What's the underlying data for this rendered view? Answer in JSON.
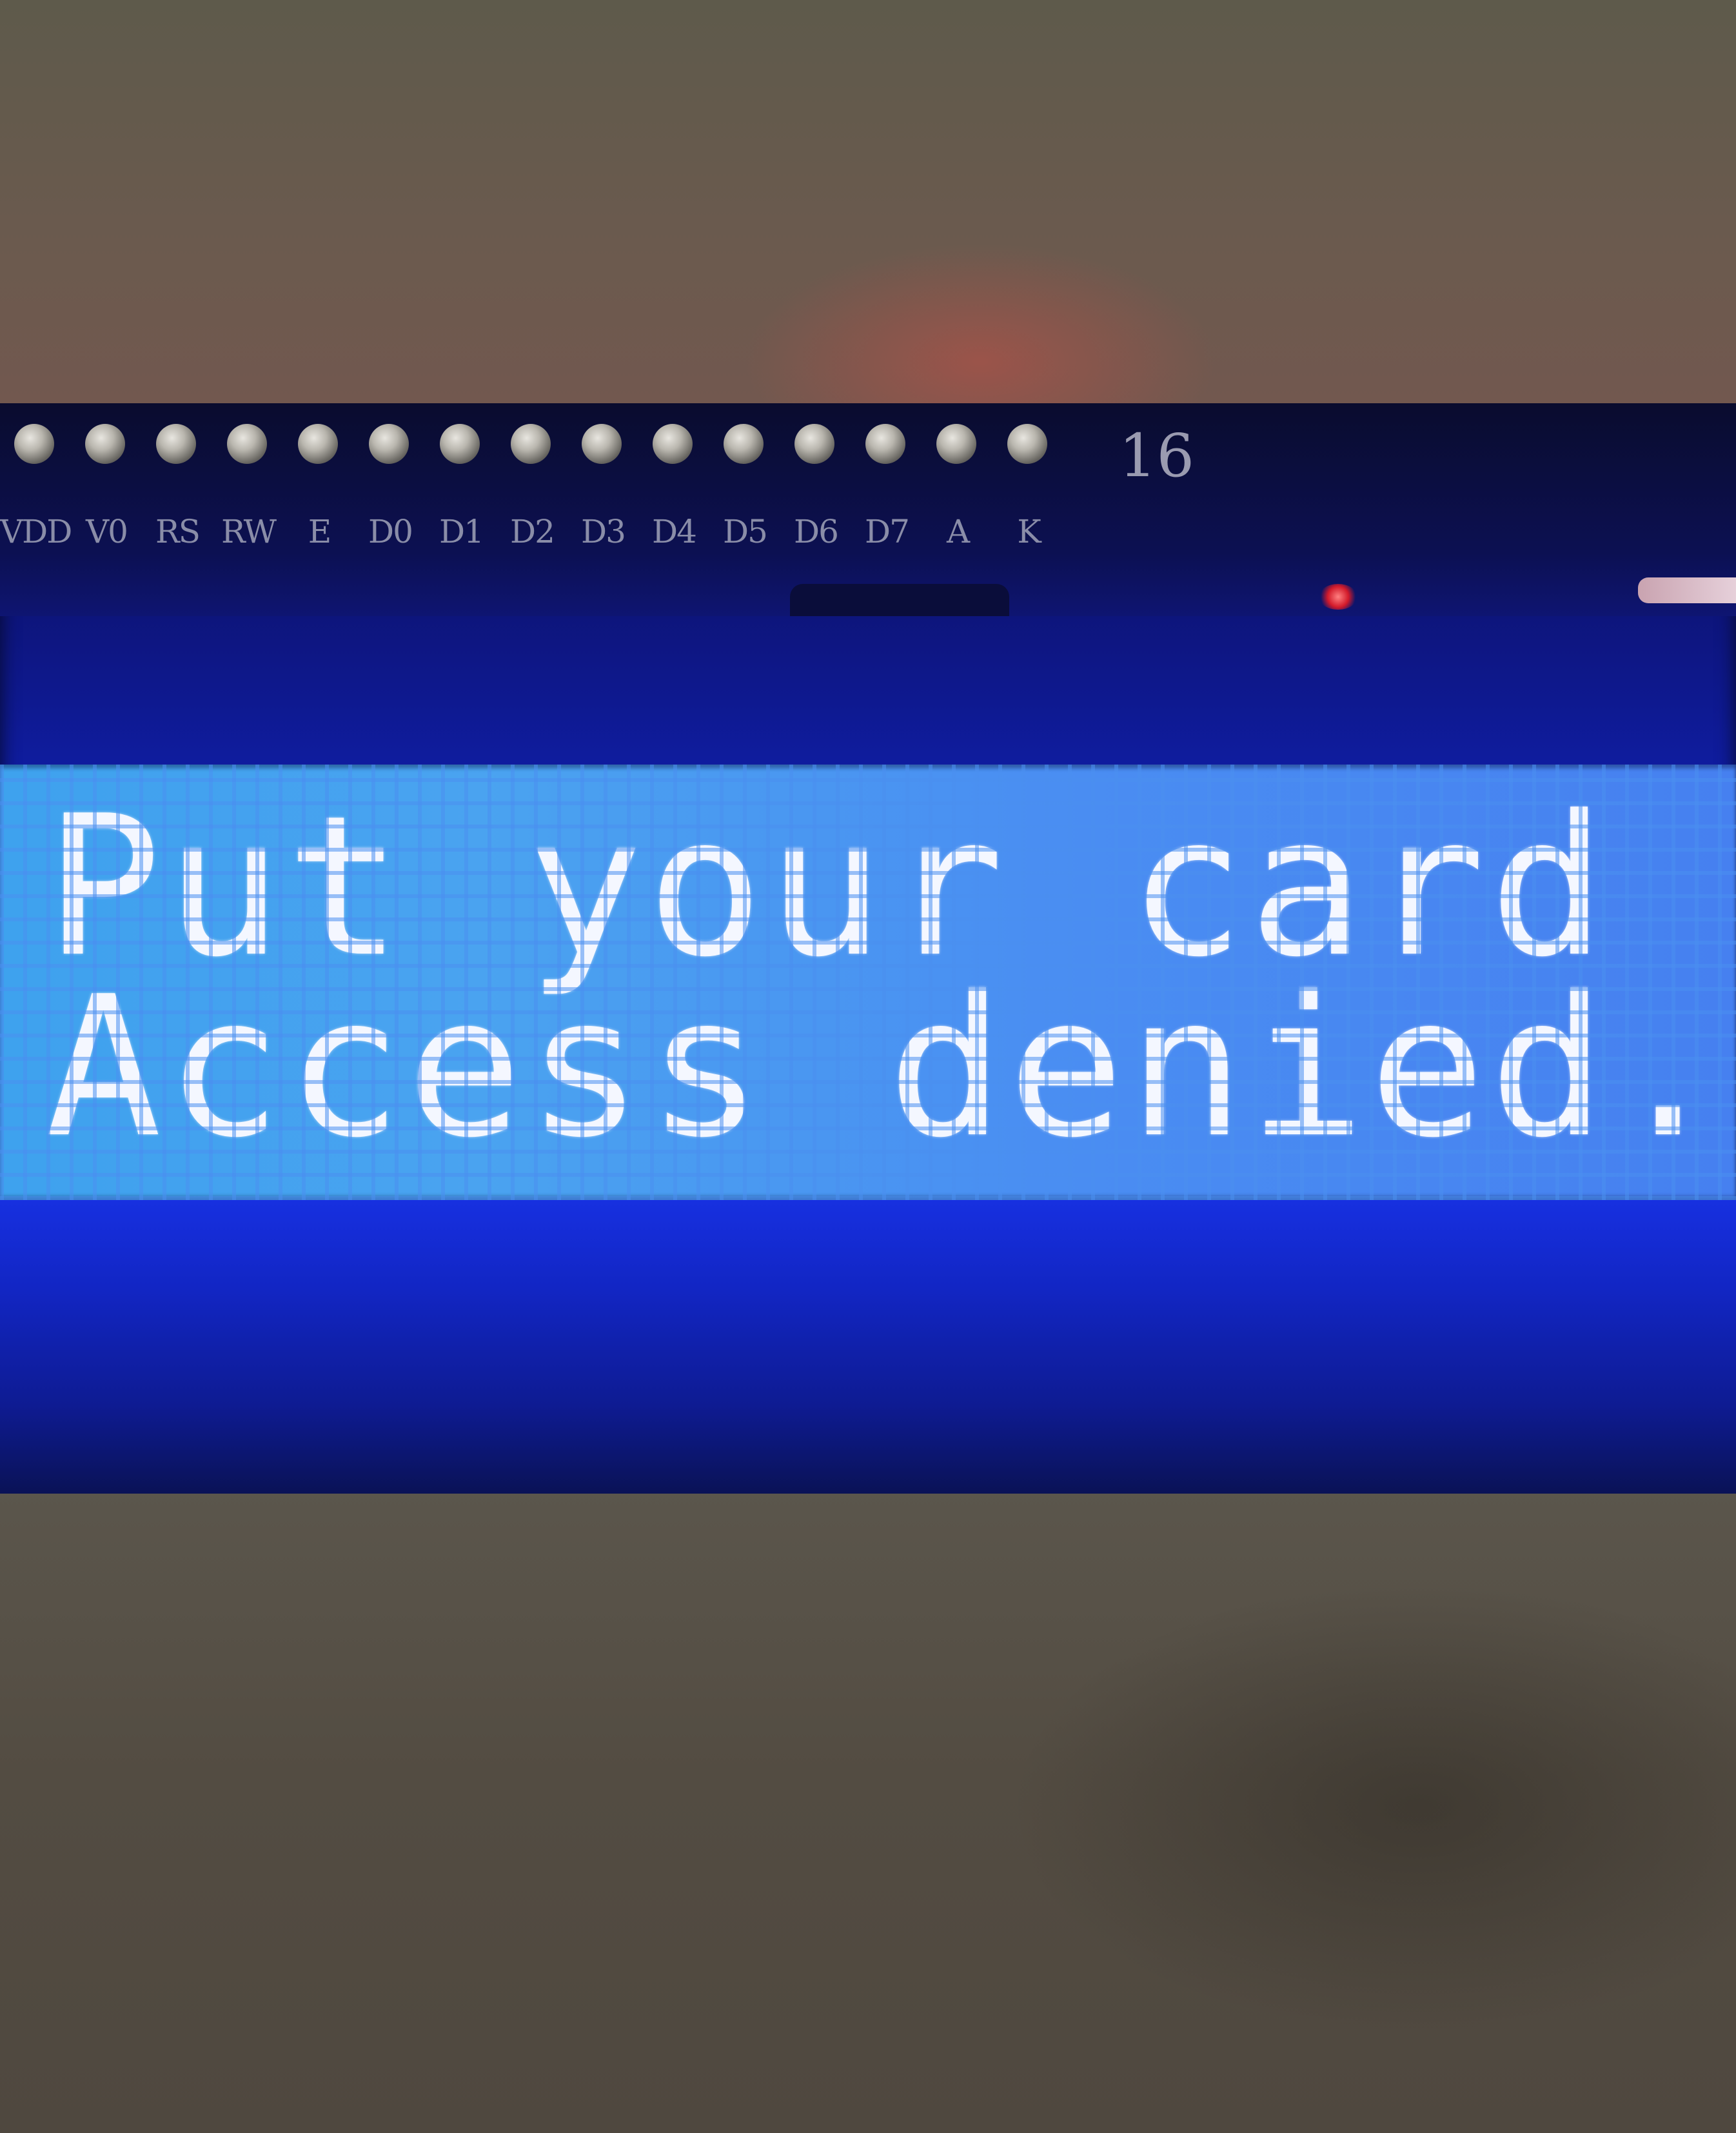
{
  "board": {
    "pin_number": "16",
    "pin_labels": [
      "VDD",
      "V0",
      "RS",
      "RW",
      "E",
      "D0",
      "D1",
      "D2",
      "D3",
      "D4",
      "D5",
      "D6",
      "D7",
      "A",
      "K"
    ]
  },
  "lcd": {
    "line1": "Put your card to",
    "line2": "Access denied..."
  },
  "colors": {
    "lcd_background": "#4aa3f0",
    "lcd_text": "#f4f7ff",
    "bezel": "#1228d8",
    "led": "#d21a2a"
  }
}
